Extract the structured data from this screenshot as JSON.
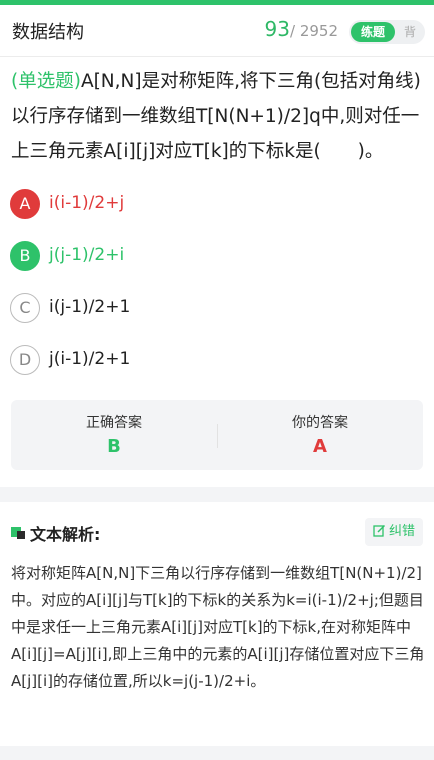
{
  "header": {
    "title": "数据结构",
    "progress_current": "93",
    "progress_total": "/ 2952",
    "mode_practice": "练题",
    "mode_recite": "背"
  },
  "question": {
    "type": "(单选题)",
    "text": "A[N,N]是对称矩阵,将下三角(包括对角线)以行序存储到一维数组T[N(N+1)/2]q中,则对任一上三角元素A[i][j]对应T[k]的下标k是(　　)。"
  },
  "options": [
    {
      "letter": "A",
      "text": "i(i-1)/2+j",
      "state": "wrong"
    },
    {
      "letter": "B",
      "text": "j(j-1)/2+i",
      "state": "correct"
    },
    {
      "letter": "C",
      "text": "i(j-1)/2+1",
      "state": "normal"
    },
    {
      "letter": "D",
      "text": "j(i-1)/2+1",
      "state": "normal"
    }
  ],
  "answers": {
    "correct_label": "正确答案",
    "correct_value": "B",
    "yours_label": "你的答案",
    "yours_value": "A"
  },
  "analysis": {
    "title": "文本解析:",
    "correct_button": "纠错",
    "text": "将对称矩阵A[N,N]下三角以行序存储到一维数组T[N(N+1)/2]中。对应的A[i][j]与T[k]的下标k的关系为k=i(i-1)/2+j;但题目中是求任一上三角元素A[i][j]对应T[k]的下标k,在对称矩阵中A[i][j]=A[j][i],即上三角中的元素的A[i][j]存储位置对应下三角A[j][i]的存储位置,所以k=j(j-1)/2+i。"
  },
  "colors": {
    "accent": "#2ec26a",
    "wrong": "#e03b3b",
    "background": "#f3f4f6"
  },
  "icons": {
    "analysis": "analysis-square-icon",
    "correct_button": "edit-icon"
  }
}
